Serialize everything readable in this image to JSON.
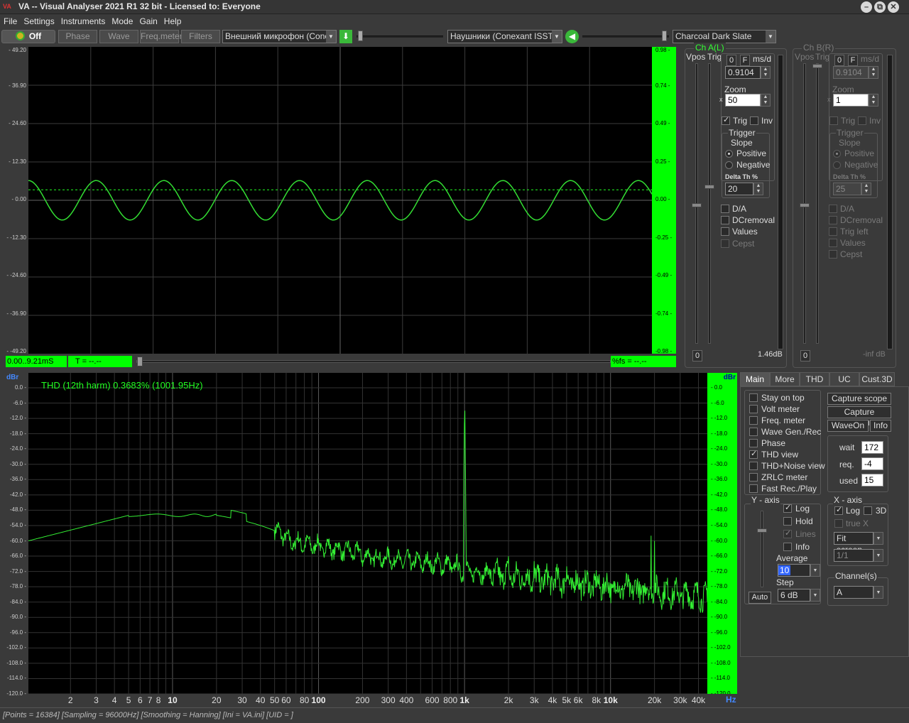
{
  "window": {
    "logo": "VA",
    "title": "VA -- Visual Analyser 2021 R1 32 bit - Licensed to: Everyone",
    "min": "–",
    "restore": "⧉",
    "close": "✕"
  },
  "menu": [
    "File",
    "Settings",
    "Instruments",
    "Mode",
    "Gain",
    "Help"
  ],
  "toolbar": {
    "power_label": "Off",
    "buttons": [
      "Phase",
      "Wave",
      "Freq.meter",
      "Filters"
    ],
    "input_device": "Внешний микрофон (Conexa",
    "output_device": "Наушники (Conexant ISST Au",
    "theme": "Charcoal Dark Slate"
  },
  "scope": {
    "y_left": [
      "49.20",
      "36.90",
      "24.60",
      "12.30",
      "0.00",
      "-12.30",
      "-24.60",
      "-36.90",
      "-49.20"
    ],
    "y_right": [
      "0.98",
      "0.74",
      "0.49",
      "0.25",
      "0.00",
      "-0.25",
      "-0.49",
      "-0.74",
      "-0.98"
    ],
    "time_range": "0.00..9.21mS",
    "t_readout": "T = --.--",
    "fs_readout": "%fs = --.--",
    "wave": {
      "cycles": 9.2,
      "amplitude": 0.117,
      "dc": 0.0,
      "trigger_level": 0.05
    }
  },
  "chA": {
    "title": "Ch A(L)",
    "vpos": "Vpos",
    "trig": "Trig",
    "o": "0",
    "f": "F",
    "msd": "ms/d",
    "msd_val": "0.9104",
    "zoom_label": "Zoom",
    "zoom_x": "x",
    "zoom_val": "50",
    "trig_cb": "Trig",
    "inv_cb": "Inv",
    "trigger_label": "Trigger",
    "slope": "Slope",
    "positive": "Positive",
    "negative": "Negative",
    "delta_label": "Delta Th %",
    "delta_val": "20",
    "da": "D/A",
    "dcremoval": "DCremoval",
    "values": "Values",
    "cepst": "Cepst",
    "bottom_left": "0",
    "bottom_right": "1.46dB"
  },
  "chB": {
    "title": "Ch B(R)",
    "vpos": "Vpos",
    "trig": "Trig",
    "o": "0",
    "f": "F",
    "msd": "ms/d",
    "msd_val": "0.9104",
    "zoom_label": "Zoom",
    "zoom_x": "x",
    "zoom_val": "1",
    "trig_cb": "Trig",
    "inv_cb": "Inv",
    "trigger_label": "Trigger",
    "slope": "Slope",
    "positive": "Positive",
    "negative": "Negative",
    "delta_label": "Delta Th %",
    "delta_val": "25",
    "da": "D/A",
    "dcremoval": "DCremoval",
    "trigleft": "Trig left",
    "values": "Values",
    "cepst": "Cepst",
    "bottom_left": "0",
    "bottom_right": "-inf dB"
  },
  "spectrum": {
    "unit_left": "dBr",
    "unit_right": "dBr",
    "thd_text": "THD (12th harm) 0.3683% (1001.95Hz)",
    "y_labels": [
      "0.0",
      "-6.0",
      "-12.0",
      "-18.0",
      "-24.0",
      "-30.0",
      "-36.0",
      "-42.0",
      "-48.0",
      "-54.0",
      "-60.0",
      "-66.0",
      "-72.0",
      "-78.0",
      "-84.0",
      "-90.0",
      "-96.0",
      "-102.0",
      "-108.0",
      "-114.0",
      "-120.0"
    ],
    "x_unit": "Hz",
    "x_labels": [
      {
        "t": "2",
        "f": 2
      },
      {
        "t": "3",
        "f": 3
      },
      {
        "t": "4",
        "f": 4
      },
      {
        "t": "5",
        "f": 5
      },
      {
        "t": "6",
        "f": 6
      },
      {
        "t": "7",
        "f": 7
      },
      {
        "t": "8",
        "f": 8
      },
      {
        "t": "10",
        "f": 10,
        "b": true
      },
      {
        "t": "20",
        "f": 20
      },
      {
        "t": "30",
        "f": 30
      },
      {
        "t": "40",
        "f": 40
      },
      {
        "t": "50",
        "f": 50
      },
      {
        "t": "60",
        "f": 60
      },
      {
        "t": "80",
        "f": 80
      },
      {
        "t": "100",
        "f": 100,
        "b": true
      },
      {
        "t": "200",
        "f": 200
      },
      {
        "t": "300",
        "f": 300
      },
      {
        "t": "400",
        "f": 400
      },
      {
        "t": "600",
        "f": 600
      },
      {
        "t": "800",
        "f": 800
      },
      {
        "t": "1k",
        "f": 1000,
        "b": true
      },
      {
        "t": "2k",
        "f": 2000
      },
      {
        "t": "3k",
        "f": 3000
      },
      {
        "t": "4k",
        "f": 4000
      },
      {
        "t": "5k",
        "f": 5000
      },
      {
        "t": "6k",
        "f": 6000
      },
      {
        "t": "8k",
        "f": 8000
      },
      {
        "t": "10k",
        "f": 10000,
        "b": true
      },
      {
        "t": "20k",
        "f": 20000
      },
      {
        "t": "30k",
        "f": 30000
      },
      {
        "t": "40k",
        "f": 40000
      }
    ]
  },
  "tabs": [
    "Main",
    "More",
    "THD",
    "UC",
    "Cust.3D"
  ],
  "main_panel": {
    "checks": [
      {
        "label": "Stay on top",
        "on": false
      },
      {
        "label": "Volt meter",
        "on": false
      },
      {
        "label": "Freq. meter",
        "on": false
      },
      {
        "label": "Wave Gen./Rec",
        "on": false
      },
      {
        "label": "Phase",
        "on": false
      },
      {
        "label": "THD view",
        "on": true
      },
      {
        "label": "THD+Noise view",
        "on": false
      },
      {
        "label": "ZRLC meter",
        "on": false
      },
      {
        "label": "Fast Rec./Play",
        "on": false
      }
    ],
    "capture_scope": "Capture scope",
    "capture_spectrum": "Capture spectrum",
    "waveon": "WaveOn",
    "info": "Info",
    "wait_label": "wait",
    "wait_val": "172",
    "req_label": "req.",
    "req_val": "-4",
    "used_label": "used",
    "used_val": "15",
    "yaxis": {
      "title": "Y - axis",
      "log": "Log",
      "hold": "Hold",
      "lines": "Lines",
      "info": "Info",
      "average": "Average",
      "average_val": "10",
      "step": "Step",
      "step_val": "6 dB",
      "auto": "Auto"
    },
    "xaxis": {
      "title": "X - axis",
      "log": "Log",
      "d3": "3D",
      "truex": "true X",
      "fit": "Fit screen",
      "ratio": "1/1"
    },
    "channels": {
      "title": "Channel(s)",
      "val": "A"
    }
  },
  "status": "[Points = 16384]  [Sampling = 96000Hz]  [Smoothing = Hanning]  [Ini = VA.ini]  [UID = ]"
}
